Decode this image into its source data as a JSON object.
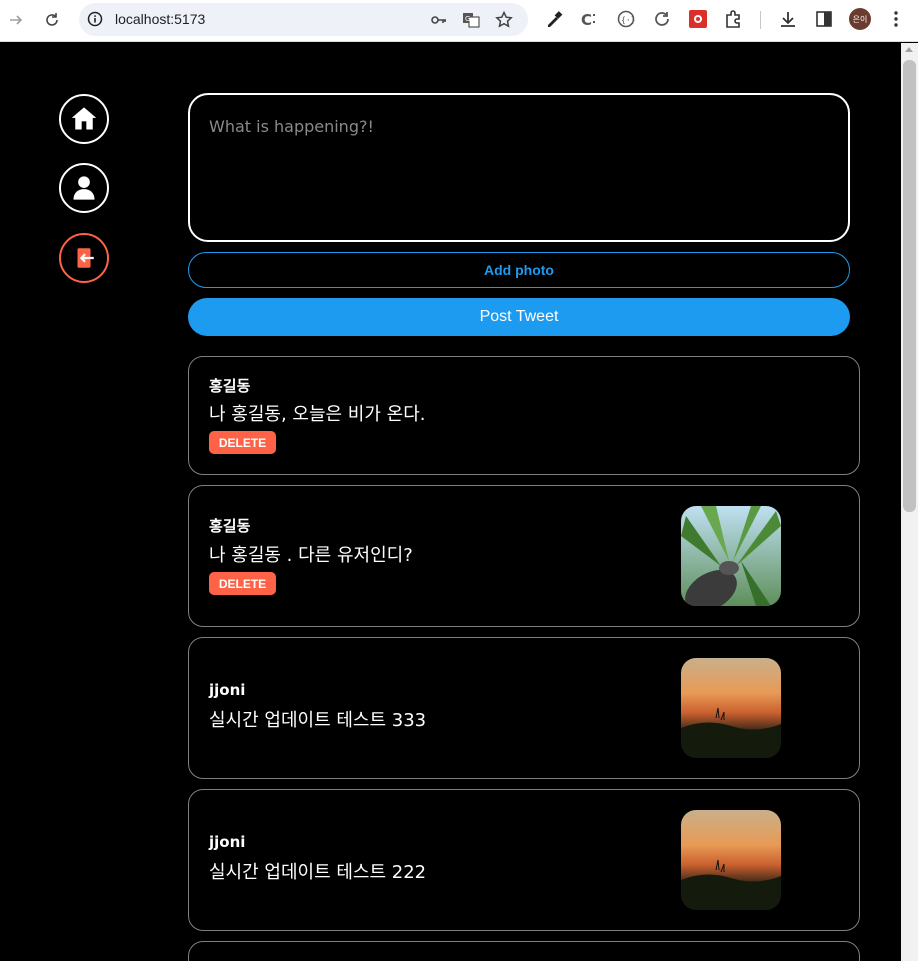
{
  "browser": {
    "url": "localhost:5173",
    "profile_initials": "은이"
  },
  "composer": {
    "placeholder": "What is happening?!",
    "add_photo_label": "Add photo",
    "post_label": "Post Tweet"
  },
  "tweets": [
    {
      "username": "홍길동",
      "payload": "나 홍길동, 오늘은 비가 온다.",
      "delete_label": "DELETE",
      "has_photo": false
    },
    {
      "username": "홍길동",
      "payload": "나 홍길동 . 다른 유저인디?",
      "delete_label": "DELETE",
      "has_photo": true,
      "photo": "palm-photo"
    },
    {
      "username": "jjoni",
      "payload": "실시간 업데이트 테스트 333",
      "has_photo": true,
      "photo": "sunset-photo"
    },
    {
      "username": "jjoni",
      "payload": "실시간 업데이트 테스트 222",
      "has_photo": true,
      "photo": "sunset-photo"
    }
  ],
  "colors": {
    "accent": "#1d9bf0",
    "danger": "#ff6347",
    "background": "#000000"
  }
}
